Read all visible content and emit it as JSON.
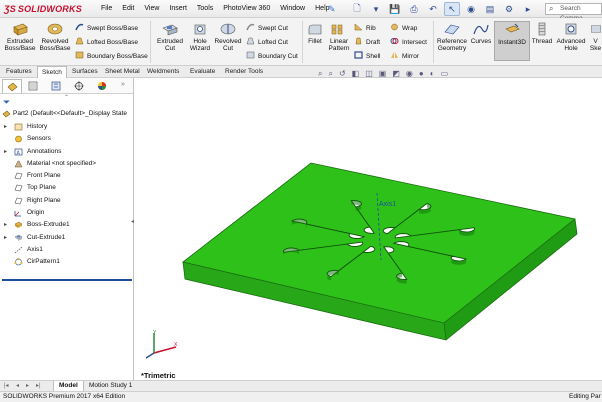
{
  "app": {
    "logo_text": "SOLIDWORKS",
    "brand_color": "#c8102e"
  },
  "menu": [
    "File",
    "Edit",
    "View",
    "Insert",
    "Tools",
    "PhotoView 360",
    "Window",
    "Help"
  ],
  "search": {
    "placeholder": "Search Comma"
  },
  "ribbon": {
    "extruded_boss": "Extruded Boss/Base",
    "revolved_boss": "Revolved Boss/Base",
    "swept_boss": "Swept Boss/Base",
    "lofted_boss": "Lofted Boss/Base",
    "boundary_boss": "Boundary Boss/Base",
    "extruded_cut": "Extruded Cut",
    "hole_wizard": "Hole Wizard",
    "revolved_cut": "Revolved Cut",
    "swept_cut": "Swept Cut",
    "lofted_cut": "Lofted Cut",
    "boundary_cut": "Boundary Cut",
    "fillet": "Fillet",
    "linear_pattern": "Linear Pattern",
    "rib": "Rib",
    "draft": "Draft",
    "shell": "Shell",
    "wrap": "Wrap",
    "intersect": "Intersect",
    "mirror": "Mirror",
    "reference_geometry": "Reference Geometry",
    "curves": "Curves",
    "instant3d": "Instant3D",
    "thread": "Thread",
    "advanced_hole": "Advanced Hole",
    "vent_sketch": "V Ske"
  },
  "tabs": [
    "Features",
    "Sketch",
    "Surfaces",
    "Sheet Metal",
    "Weldments",
    "Evaluate",
    "Render Tools"
  ],
  "tree": {
    "root": "Part2  (Default<<Default>_Display State",
    "items": [
      {
        "label": "History",
        "expand": "▸"
      },
      {
        "label": "Sensors",
        "expand": ""
      },
      {
        "label": "Annotations",
        "expand": "▸"
      },
      {
        "label": "Material <not specified>",
        "expand": ""
      },
      {
        "label": "Front Plane",
        "expand": ""
      },
      {
        "label": "Top Plane",
        "expand": ""
      },
      {
        "label": "Right Plane",
        "expand": ""
      },
      {
        "label": "Origin",
        "expand": ""
      },
      {
        "label": "Boss-Extrude1",
        "expand": "▸"
      },
      {
        "label": "Cut-Extrude1",
        "expand": "▸"
      },
      {
        "label": "Axis1",
        "expand": ""
      },
      {
        "label": "CirPattern1",
        "expand": ""
      }
    ]
  },
  "graphics": {
    "axis_label": "Axis1",
    "view_name": "*Trimetric",
    "part_color": "#2ec11a"
  },
  "bottom_tabs": [
    "Model",
    "Motion Study 1"
  ],
  "status": {
    "left": "SOLIDWORKS Premium 2017 x64 Edition",
    "right": "Editing Par"
  }
}
